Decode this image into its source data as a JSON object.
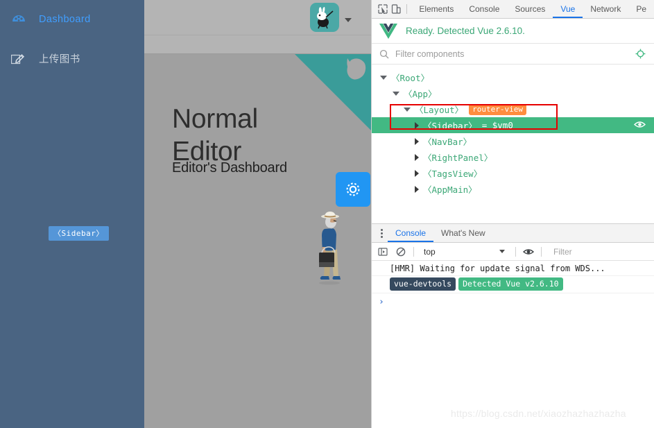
{
  "sidebar": {
    "items": [
      {
        "label": "Dashboard",
        "icon": "dashboard-icon",
        "active": true
      },
      {
        "label": "上传图书",
        "icon": "edit-square-icon",
        "active": false
      }
    ],
    "hover_tooltip": "〈Sidebar〉",
    "bg_color": "#4a6482",
    "active_color": "#409eff"
  },
  "app": {
    "navbar": {
      "avatar_alt": "rabbit-avatar",
      "dropdown_caret": "▼"
    },
    "hero": {
      "title_line1": "Normal",
      "title_line2": "Editor",
      "subtitle": "Editor's Dashboard"
    },
    "gear_button_label": "settings-gear",
    "accent_teal": "#3a9c99",
    "accent_blue": "#2196f3"
  },
  "devtools": {
    "tabs": [
      {
        "label": "Elements",
        "active": false
      },
      {
        "label": "Console",
        "active": false
      },
      {
        "label": "Sources",
        "active": false
      },
      {
        "label": "Vue",
        "active": true
      },
      {
        "label": "Network",
        "active": false
      },
      {
        "label": "Pe",
        "active": false
      }
    ],
    "vue_panel": {
      "status": "Ready. Detected Vue 2.6.10.",
      "status_color": "#3ba776",
      "filter_placeholder": "Filter components",
      "tree": [
        {
          "name": "〈Root〉",
          "depth": 0,
          "arrow": "open",
          "selected": false,
          "badge": null,
          "vm": null
        },
        {
          "name": "〈App〉",
          "depth": 1,
          "arrow": "open",
          "selected": false,
          "badge": null,
          "vm": null
        },
        {
          "name": "〈Layout〉",
          "depth": 2,
          "arrow": "open",
          "selected": false,
          "badge": "router-view",
          "vm": null
        },
        {
          "name": "〈Sidebar〉",
          "depth": 3,
          "arrow": "closed",
          "selected": true,
          "badge": null,
          "vm": "= $vm0"
        },
        {
          "name": "〈NavBar〉",
          "depth": 3,
          "arrow": "closed",
          "selected": false,
          "badge": null,
          "vm": null
        },
        {
          "name": "〈RightPanel〉",
          "depth": 3,
          "arrow": "closed",
          "selected": false,
          "badge": null,
          "vm": null
        },
        {
          "name": "〈TagsView〉",
          "depth": 3,
          "arrow": "closed",
          "selected": false,
          "badge": null,
          "vm": null
        },
        {
          "name": "〈AppMain〉",
          "depth": 3,
          "arrow": "closed",
          "selected": false,
          "badge": null,
          "vm": null
        }
      ],
      "selected_highlight": "#42b983",
      "badge_color": "#ff8d3f",
      "annotation_color": "#e60000"
    },
    "drawer": {
      "tabs": [
        {
          "label": "Console",
          "active": true
        },
        {
          "label": "What's New",
          "active": false
        }
      ],
      "context_value": "top",
      "filter_placeholder": "Filter",
      "logs": [
        {
          "type": "text",
          "text": "[HMR] Waiting for update signal from WDS..."
        },
        {
          "type": "badges",
          "badge_dark": "vue-devtools",
          "badge_green": "Detected Vue v2.6.10"
        }
      ],
      "prompt": "›"
    }
  },
  "watermark": "https://blog.csdn.net/xiaozhazhazhazha"
}
